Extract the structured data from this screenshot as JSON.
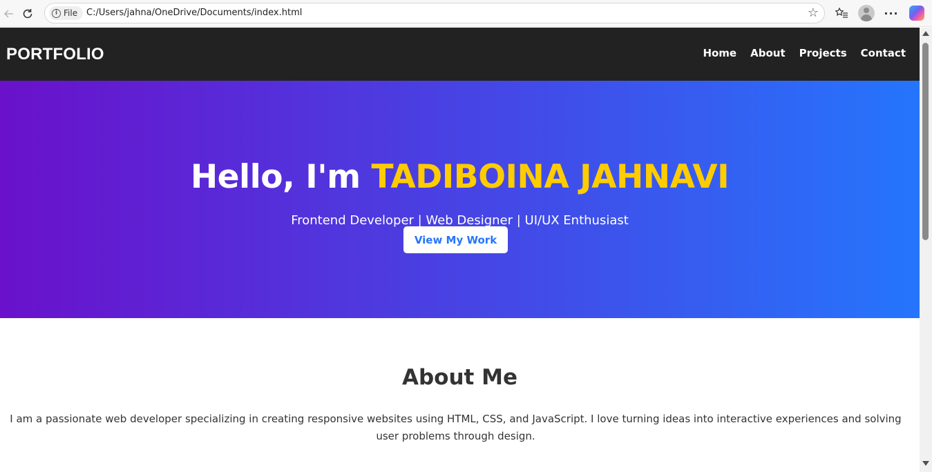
{
  "browser": {
    "file_chip": "File",
    "url": "C:/Users/jahna/OneDrive/Documents/index.html"
  },
  "nav": {
    "logo": "PORTFOLIO",
    "links": [
      "Home",
      "About",
      "Projects",
      "Contact"
    ]
  },
  "hero": {
    "greeting": "Hello, I'm ",
    "name": "TADIBOINA JAHNAVI",
    "subtitle": "Frontend Developer | Web Designer | UI/UX Enthusiast",
    "button": "View My Work"
  },
  "about": {
    "title": "About Me",
    "text": "I am a passionate web developer specializing in creating responsive websites using HTML, CSS, and JavaScript. I love turning ideas into interactive experiences and solving user problems through design."
  },
  "colors": {
    "nav_bg": "#222222",
    "gradient_start": "#6a11cb",
    "gradient_end": "#2575fc",
    "name_highlight": "#ffcc00",
    "button_text": "#2575fc"
  }
}
